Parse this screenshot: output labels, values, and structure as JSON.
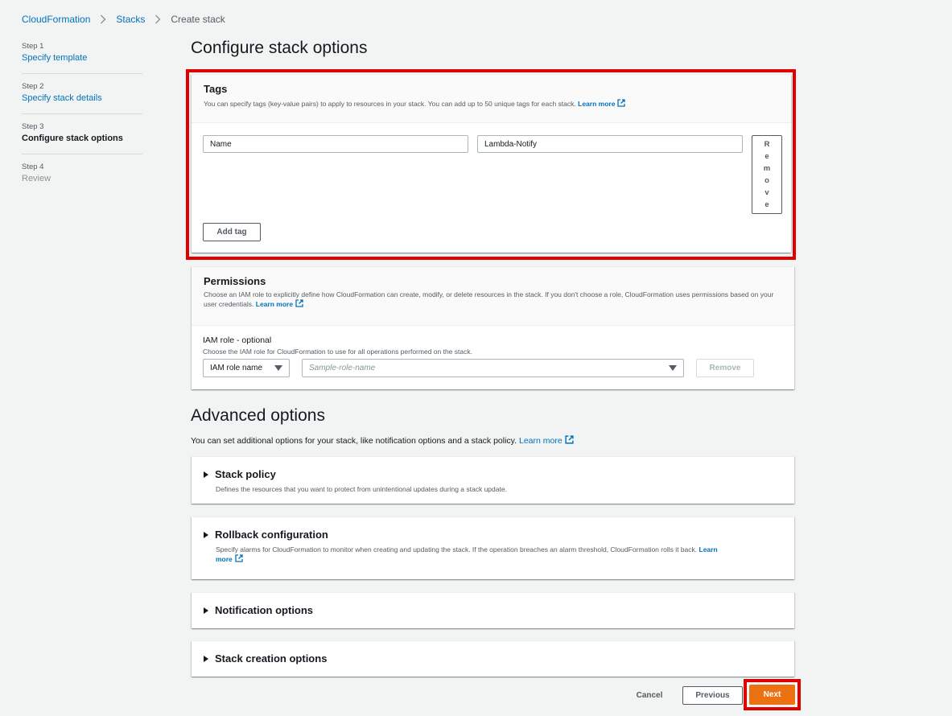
{
  "breadcrumb": {
    "items": [
      "CloudFormation",
      "Stacks"
    ],
    "current": "Create stack"
  },
  "steps": [
    {
      "num": "Step 1",
      "label": "Specify template",
      "state": "link"
    },
    {
      "num": "Step 2",
      "label": "Specify stack details",
      "state": "link"
    },
    {
      "num": "Step 3",
      "label": "Configure stack options",
      "state": "active"
    },
    {
      "num": "Step 4",
      "label": "Review",
      "state": "disabled"
    }
  ],
  "page_title": "Configure stack options",
  "tags": {
    "title": "Tags",
    "description": "You can specify tags (key-value pairs) to apply to resources in your stack. You can add up to 50 unique tags for each stack.",
    "learn_more": "Learn more",
    "key_value": "Name",
    "value_value": "Lambda-Notify",
    "remove_letters": [
      "R",
      "e",
      "m",
      "o",
      "v",
      "e"
    ],
    "add_tag_label": "Add tag"
  },
  "permissions": {
    "title": "Permissions",
    "description": "Choose an IAM role to explicitly define how CloudFormation can create, modify, or delete resources in the stack. If you don't choose a role, CloudFormation uses permissions based on your user credentials.",
    "learn_more": "Learn more",
    "iam_label": "IAM role - optional",
    "iam_desc": "Choose the IAM role for CloudFormation to use for all operations performed on the stack.",
    "iam_select": "IAM role name",
    "role_placeholder": "Sample-role-name",
    "remove_label": "Remove"
  },
  "advanced": {
    "title": "Advanced options",
    "description": "You can set additional options for your stack, like notification options and a stack policy.",
    "learn_more": "Learn more",
    "sections": {
      "stack_policy": {
        "title": "Stack policy",
        "desc": "Defines the resources that you want to protect from unintentional updates during a stack update."
      },
      "rollback": {
        "title": "Rollback configuration",
        "desc": "Specify alarms for CloudFormation to monitor when creating and updating the stack. If the operation breaches an alarm threshold, CloudFormation rolls it back.",
        "learn_more_1": "Learn",
        "learn_more_2": "more"
      },
      "notification": {
        "title": "Notification options"
      },
      "creation": {
        "title": "Stack creation options"
      }
    }
  },
  "footer": {
    "cancel": "Cancel",
    "previous": "Previous",
    "next": "Next"
  },
  "colors": {
    "accent_link": "#0073bb",
    "primary_button": "#ec7211",
    "highlight": "#e00000"
  }
}
